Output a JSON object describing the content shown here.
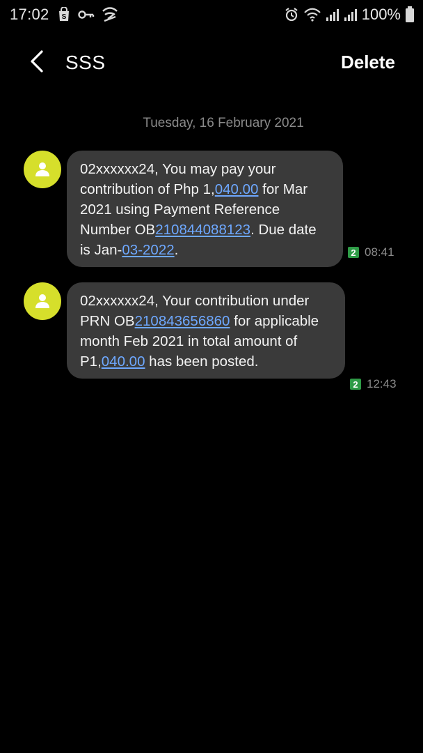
{
  "status_bar": {
    "time": "17:02",
    "battery_text": "100%",
    "left_icons": [
      "shop-icon",
      "key-icon",
      "network-speed-icon"
    ],
    "right_icons": [
      "alarm-icon",
      "wifi-icon",
      "signal-icon",
      "signal-icon",
      "battery-icon"
    ]
  },
  "header": {
    "title": "SSS",
    "delete_label": "Delete"
  },
  "conversation": {
    "date_separator": "Tuesday, 16 February 2021",
    "messages": [
      {
        "parts": [
          {
            "text": "02xxxxxx24, You may pay your contribution of Php 1,"
          },
          {
            "text": "040.00",
            "link": true
          },
          {
            "text": " for Mar 2021 using Payment Reference Number OB"
          },
          {
            "text": "210844088123",
            "link": true
          },
          {
            "text": ". Due date is Jan-"
          },
          {
            "text": "03-2022",
            "link": true
          },
          {
            "text": "."
          }
        ],
        "sim": "2",
        "time": "08:41"
      },
      {
        "parts": [
          {
            "text": "02xxxxxx24, Your contribution under PRN OB"
          },
          {
            "text": "210843656860",
            "link": true
          },
          {
            "text": " for applicable month Feb 2021 in total amount of P1,"
          },
          {
            "text": "040.00",
            "link": true
          },
          {
            "text": " has been posted."
          }
        ],
        "sim": "2",
        "time": "12:43"
      }
    ]
  },
  "colors": {
    "background": "#000000",
    "bubble": "#3a3a3a",
    "avatar": "#d6df2b",
    "link": "#6ea8ff",
    "sim_badge": "#2e9b46"
  }
}
